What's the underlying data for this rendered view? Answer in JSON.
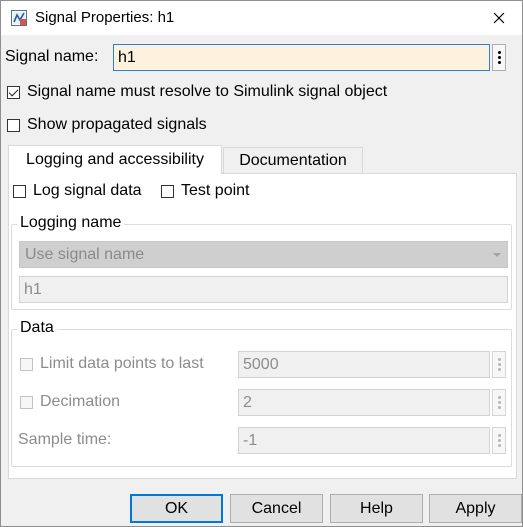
{
  "window": {
    "title": "Signal Properties: h1"
  },
  "signal_name": {
    "label": "Signal name:",
    "value": "h1"
  },
  "options": {
    "resolve_label": "Signal name must resolve to Simulink signal object",
    "resolve_checked": true,
    "propagated_label": "Show propagated signals",
    "propagated_checked": false
  },
  "tabs": [
    {
      "label": "Logging and accessibility",
      "active": true
    },
    {
      "label": "Documentation",
      "active": false
    }
  ],
  "logging": {
    "log_signal_label": "Log signal data",
    "log_signal_checked": false,
    "test_point_label": "Test point",
    "test_point_checked": false,
    "logging_name_group": "Logging name",
    "logging_name_selected": "Use signal name",
    "logging_name_value": "h1"
  },
  "data_group": {
    "title": "Data",
    "limit_label": "Limit data points to last",
    "limit_checked": false,
    "limit_value": "5000",
    "decimation_label": "Decimation",
    "decimation_checked": false,
    "decimation_value": "2",
    "sample_time_label": "Sample time:",
    "sample_time_value": "-1"
  },
  "buttons": {
    "ok": "OK",
    "cancel": "Cancel",
    "help": "Help",
    "apply": "Apply"
  },
  "colors": {
    "accent": "#0078d7",
    "name_field_bg": "#fdf2de"
  }
}
